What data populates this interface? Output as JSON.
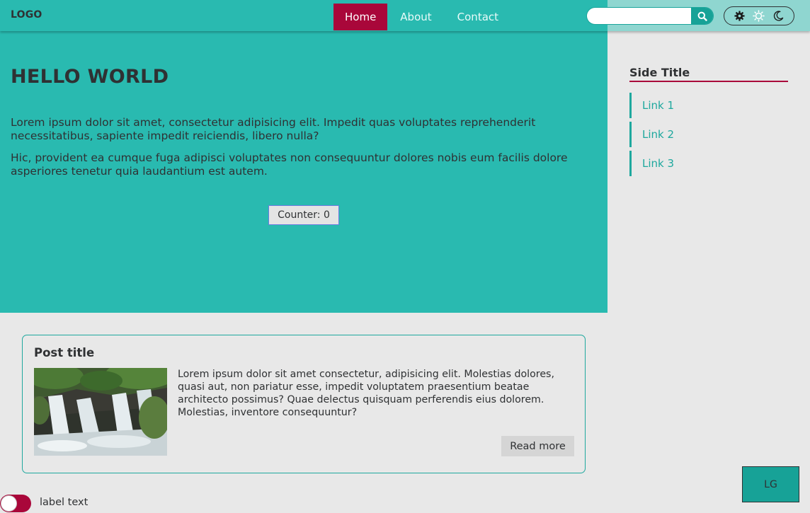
{
  "header": {
    "logo": "LOGO",
    "nav": [
      {
        "label": "Home",
        "active": true
      },
      {
        "label": "About",
        "active": false
      },
      {
        "label": "Contact",
        "active": false
      }
    ],
    "search": {
      "value": "",
      "placeholder": "",
      "icon": "search-icon"
    },
    "theme_options": [
      "gear-icon",
      "sun-icon",
      "moon-icon"
    ]
  },
  "hero": {
    "title": "HELLO WORLD",
    "paragraphs": [
      "Lorem ipsum dolor sit amet, consectetur adipisicing elit. Impedit quas voluptates reprehenderit necessitatibus, sapiente impedit reiciendis, libero nulla?",
      "Hic, provident ea cumque fuga adipisci voluptates non consequuntur dolores nobis eum facilis dolore asperiores tenetur quia laudantium est autem."
    ],
    "counter_label": "Counter: 0"
  },
  "sidebar": {
    "title": "Side Title",
    "links": [
      "Link 1",
      "Link 2",
      "Link 3"
    ]
  },
  "post": {
    "title": "Post title",
    "text": "Lorem ipsum dolor sit amet consectetur, adipisicing elit. Molestias dolores, quasi aut, non pariatur esse, impedit voluptatem praesentium beatae architecto possimus? Quae delectus quisquam perferendis eius dolorem. Molestias, inventore consequuntur?",
    "read_more": "Read more"
  },
  "lg_button": "LG",
  "toggle": {
    "label": "label text",
    "on": true
  },
  "colors": {
    "primary": "#29bab0",
    "accent": "#a9073a",
    "link": "#1ea89e",
    "background": "#e8e8e8",
    "text": "#2f3133"
  }
}
